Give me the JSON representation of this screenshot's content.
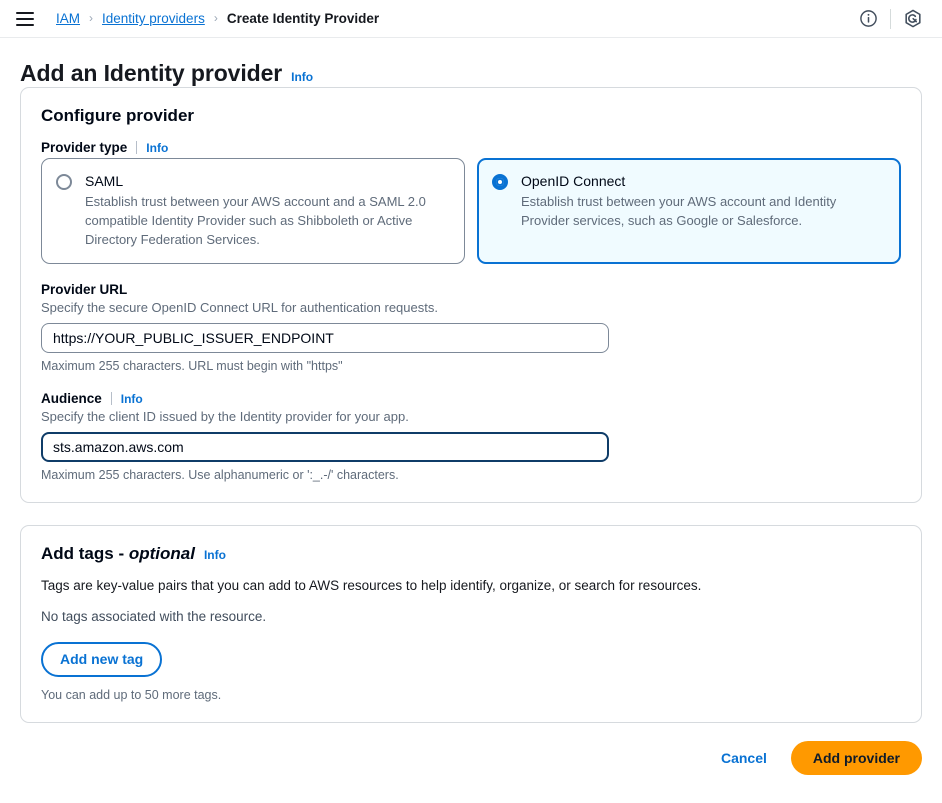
{
  "topbar": {
    "menu_icon": "hamburger-menu-icon",
    "breadcrumb": [
      {
        "label": "IAM",
        "type": "link"
      },
      {
        "label": "Identity providers",
        "type": "link"
      },
      {
        "label": "Create Identity Provider",
        "type": "current"
      }
    ],
    "separator": "›",
    "info_icon": "info-circle-icon",
    "app_icon": "hexagon-swirl-icon"
  },
  "page": {
    "title": "Add an Identity provider",
    "info_label": "Info"
  },
  "configure_provider": {
    "title": "Configure provider",
    "provider_type": {
      "label": "Provider type",
      "info_label": "Info",
      "options": [
        {
          "value": "saml",
          "label": "SAML",
          "description": "Establish trust between your AWS account and a SAML 2.0 compatible Identity Provider such as Shibboleth or Active Directory Federation Services.",
          "selected": false
        },
        {
          "value": "oidc",
          "label": "OpenID Connect",
          "description": "Establish trust between your AWS account and Identity Provider services, such as Google or Salesforce.",
          "selected": true
        }
      ]
    },
    "provider_url": {
      "label": "Provider URL",
      "description": "Specify the secure OpenID Connect URL for authentication requests.",
      "value": "https://YOUR_PUBLIC_ISSUER_ENDPOINT",
      "placeholder": "https://YOUR_PUBLIC_ISSUER_ENDPOINT",
      "hint": "Maximum 255 characters. URL must begin with \"https\"",
      "focused": false
    },
    "audience": {
      "label": "Audience",
      "info_label": "Info",
      "description": "Specify the client ID issued by the Identity provider for your app.",
      "value": "sts.amazon.aws.com",
      "placeholder": "sts.amazon.aws.com",
      "hint": "Maximum 255 characters. Use alphanumeric or ':_.-/' characters.",
      "focused": true
    }
  },
  "add_tags": {
    "title_main": "Add tags - ",
    "title_optional": "optional",
    "info_label": "Info",
    "description": "Tags are key-value pairs that you can add to AWS resources to help identify, organize, or search for resources.",
    "empty_state": "No tags associated with the resource.",
    "add_button": "Add new tag",
    "footnote": "You can add up to 50 more tags."
  },
  "actions": {
    "cancel": "Cancel",
    "submit": "Add provider"
  },
  "colors": {
    "link": "#0972d3",
    "primary_button": "#ff9900",
    "selected_tile_bg": "#f0fbff",
    "focus_border": "#0f3c68",
    "border": "#7d8998"
  }
}
